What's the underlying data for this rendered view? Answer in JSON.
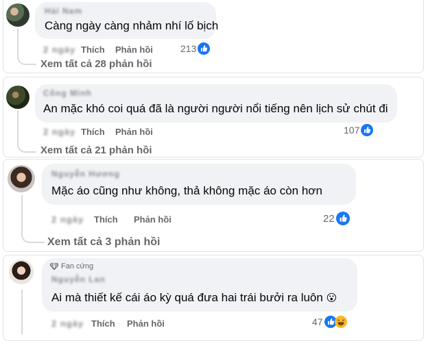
{
  "comments": [
    {
      "author": "Hải Nam",
      "text": "Càng ngày càng nhảm nhí lố bịch",
      "time": "2 ngày",
      "like_label": "Thích",
      "reply_label": "Phản hồi",
      "reaction_count": "213",
      "view_replies": "Xem tất cả 28 phản hồi"
    },
    {
      "author": "Công Minh",
      "text": "An mặc khó coi quá đã là người người nổi tiếng nên lịch sử chút đi",
      "time": "2 ngày",
      "like_label": "Thích",
      "reply_label": "Phản hồi",
      "reaction_count": "107",
      "view_replies": "Xem tất cả 21 phản hồi"
    },
    {
      "author": "Nguyễn Hương",
      "text": "Mặc áo cũng như không, thả không mặc áo còn hơn",
      "time": "2 ngày",
      "like_label": "Thích",
      "reply_label": "Phản hồi",
      "reaction_count": "22",
      "view_replies": "Xem tất cả 3 phản hồi"
    },
    {
      "badge": "Fan cứng",
      "author": "Nguyễn Lan",
      "text": "Ai mà thiết kế cái áo kỳ quá đưa hai trái bưởi ra luôn",
      "emoji": "😮",
      "time": "2 ngày",
      "like_label": "Thích",
      "reply_label": "Phản hồi",
      "reaction_count": "47"
    }
  ],
  "colors": {
    "like_blue": "#1877f2",
    "bubble_bg": "#f0f2f5",
    "meta_gray": "#65676b",
    "haha_yellow": "#f7b928"
  }
}
